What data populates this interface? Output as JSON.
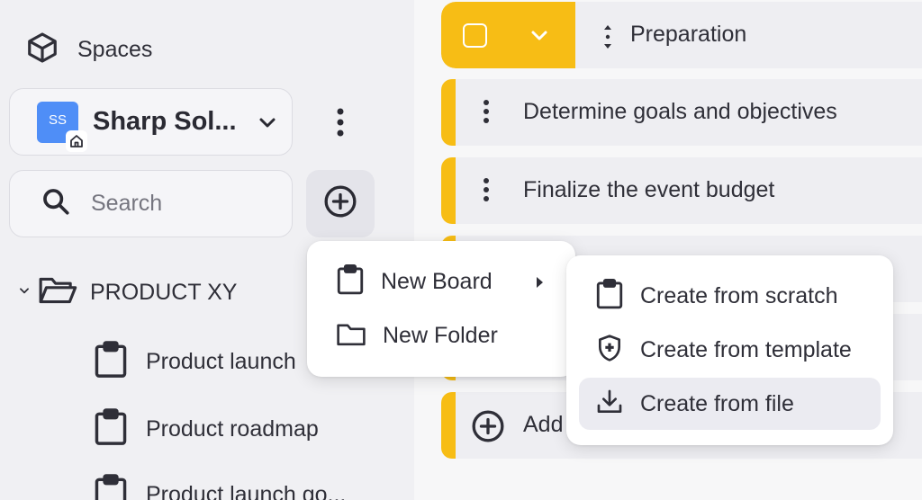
{
  "sidebar": {
    "spaces_label": "Spaces",
    "workspace": {
      "initials": "SS",
      "name": "Sharp Sol..."
    },
    "search_placeholder": "Search",
    "folder": {
      "name": "PRODUCT XY"
    },
    "boards": [
      {
        "name": "Product launch"
      },
      {
        "name": "Product roadmap"
      },
      {
        "name": "Product launch go..."
      }
    ]
  },
  "board": {
    "group_title": "Preparation",
    "tasks": [
      {
        "title": "Determine goals and objectives"
      },
      {
        "title": "Finalize the event budget"
      }
    ],
    "add_label": "Add"
  },
  "add_menu": {
    "items": [
      {
        "label": "New Board",
        "icon": "clipboard-icon",
        "has_submenu": true
      },
      {
        "label": "New Folder",
        "icon": "folder-icon",
        "has_submenu": false
      }
    ]
  },
  "board_submenu": {
    "items": [
      {
        "label": "Create from scratch",
        "icon": "clipboard-icon"
      },
      {
        "label": "Create from template",
        "icon": "shield-plus-icon"
      },
      {
        "label": "Create from file",
        "icon": "download-icon",
        "highlighted": true
      }
    ]
  },
  "colors": {
    "accent_yellow": "#f7bd15",
    "avatar_blue": "#4f8ef7",
    "sidebar_bg": "#f0f0f3"
  }
}
